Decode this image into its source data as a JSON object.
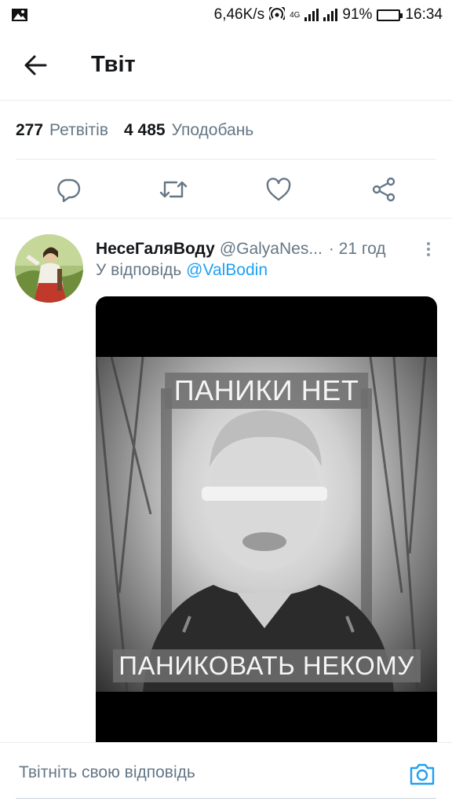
{
  "status_bar": {
    "speed": "6,46K/s",
    "network": "4G",
    "battery": "91%",
    "battery_level": 0.91,
    "time": "16:34"
  },
  "header": {
    "title": "Твіт"
  },
  "stats": {
    "retweets_count": "277",
    "retweets_label": "Ретвітів",
    "likes_count": "4 485",
    "likes_label": "Уподобань"
  },
  "reply": {
    "name": "НесеГаляВоду",
    "handle": "@GalyaNes...",
    "time": "· 21 год",
    "reply_prefix": "У відповідь",
    "reply_mention": "@ValBodin",
    "image_caption_top": "ПАНИКИ НЕТ",
    "image_caption_bottom": "ПАНИКОВАТЬ НЕКОМУ"
  },
  "compose": {
    "placeholder": "Твітніть свою відповідь"
  },
  "colors": {
    "accent": "#1da1f2",
    "muted": "#657786",
    "text": "#14171a"
  },
  "icons": [
    "image-icon",
    "hotspot-icon",
    "signal-icon",
    "battery-icon",
    "back-arrow-icon",
    "reply-icon",
    "retweet-icon",
    "like-icon",
    "share-icon",
    "more-icon",
    "camera-icon"
  ]
}
